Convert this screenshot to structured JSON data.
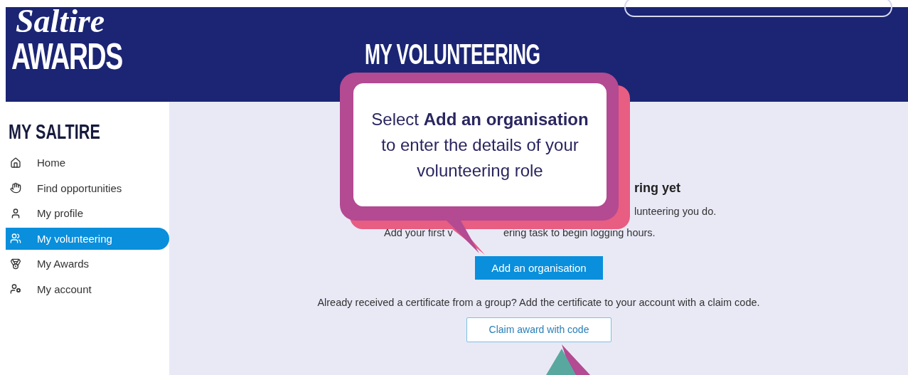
{
  "header": {
    "logo": {
      "script": "Saltire",
      "word": "AWARDS"
    },
    "title": "MY VOLUNTEERING"
  },
  "sidebar": {
    "title": "MY SALTIRE",
    "items": [
      {
        "label": "Home",
        "selected": false
      },
      {
        "label": "Find opportunities",
        "selected": false
      },
      {
        "label": "My profile",
        "selected": false
      },
      {
        "label": "My volunteering",
        "selected": true
      },
      {
        "label": "My Awards",
        "selected": false
      },
      {
        "label": "My account",
        "selected": false
      }
    ]
  },
  "main": {
    "heading_fragment": "ring yet",
    "intro_fragment": "lunteering you do.",
    "task_fragments": [
      "Add your first v",
      "ering task to begin logging hours."
    ],
    "add_button": "Add an organisation",
    "claim_text": "Already received a certificate from a group? Add the certificate to your account with a claim code.",
    "claim_button": "Claim award with code"
  },
  "callout": {
    "text": "Select **Add an organisation** to enter the details of your volunteering role"
  }
}
